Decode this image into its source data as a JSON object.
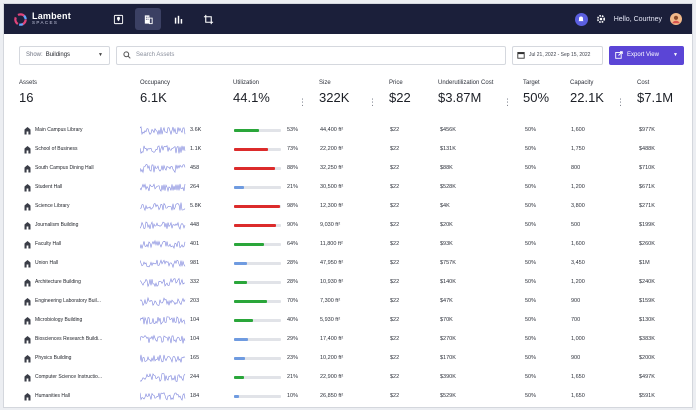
{
  "app": {
    "logo_name": "Lambent",
    "logo_sub": "SPACES",
    "greeting": "Hello, Courtney"
  },
  "nav": [
    "map-pin-icon",
    "building-icon",
    "bar-chart-icon",
    "crop-icon"
  ],
  "filters": {
    "show_label": "Show:",
    "show_value": "Buildings",
    "search_placeholder": "Search Assets",
    "date_range": "Jul 21, 2022 - Sep 15, 2022",
    "export_label": "Export View"
  },
  "summary": [
    {
      "label": "Assets",
      "value": "16"
    },
    {
      "label": "Occupancy",
      "value": "6.1K"
    },
    {
      "label": "Utilization",
      "value": "44.1%"
    },
    {
      "label": "Size",
      "value": "322K"
    },
    {
      "label": "Price",
      "value": "$22"
    },
    {
      "label": "Underutilization Cost",
      "value": "$3.87M"
    },
    {
      "label": "Target",
      "value": "50%"
    },
    {
      "label": "Capacity",
      "value": "22.1K"
    },
    {
      "label": "Cost",
      "value": "$7.1M"
    }
  ],
  "colors": {
    "good": "#2aa63a",
    "bad": "#dc2b2b",
    "low": "#6f9be0",
    "spark": "#7d85dc",
    "accent": "#5b45d6",
    "header": "#1b1f3a"
  },
  "rows": [
    {
      "name": "Main Campus Library",
      "occ": "3.6K",
      "util": "53%",
      "util_pct": 53,
      "status": "good",
      "size": "44,400 ft²",
      "price": "$22",
      "uc": "$456K",
      "target": "50%",
      "cap": "1,600",
      "cost": "$977K"
    },
    {
      "name": "School of Business",
      "occ": "1.1K",
      "util": "73%",
      "util_pct": 73,
      "status": "bad",
      "size": "22,200 ft²",
      "price": "$22",
      "uc": "$131K",
      "target": "50%",
      "cap": "1,750",
      "cost": "$488K"
    },
    {
      "name": "South Campus Dining Hall",
      "occ": "458",
      "util": "88%",
      "util_pct": 88,
      "status": "bad",
      "size": "32,250 ft²",
      "price": "$22",
      "uc": "$88K",
      "target": "50%",
      "cap": "800",
      "cost": "$710K"
    },
    {
      "name": "Student Hall",
      "occ": "264",
      "util": "21%",
      "util_pct": 21,
      "status": "low",
      "size": "30,500 ft²",
      "price": "$22",
      "uc": "$528K",
      "target": "50%",
      "cap": "1,200",
      "cost": "$671K"
    },
    {
      "name": "Science Library",
      "occ": "5.8K",
      "util": "98%",
      "util_pct": 98,
      "status": "bad",
      "size": "12,300 ft²",
      "price": "$22",
      "uc": "$4K",
      "target": "50%",
      "cap": "3,800",
      "cost": "$271K"
    },
    {
      "name": "Journalism Building",
      "occ": "448",
      "util": "90%",
      "util_pct": 90,
      "status": "bad",
      "size": "9,030 ft²",
      "price": "$22",
      "uc": "$20K",
      "target": "50%",
      "cap": "500",
      "cost": "$199K"
    },
    {
      "name": "Faculty Hall",
      "occ": "401",
      "util": "64%",
      "util_pct": 64,
      "status": "good",
      "size": "11,800 ft²",
      "price": "$22",
      "uc": "$93K",
      "target": "50%",
      "cap": "1,600",
      "cost": "$260K"
    },
    {
      "name": "Union Hall",
      "occ": "981",
      "util": "28%",
      "util_pct": 28,
      "status": "low",
      "size": "47,950 ft²",
      "price": "$22",
      "uc": "$757K",
      "target": "50%",
      "cap": "3,450",
      "cost": "$1M"
    },
    {
      "name": "Architecture Building",
      "occ": "332",
      "util": "28%",
      "util_pct": 28,
      "status": "good",
      "size": "10,930 ft²",
      "price": "$22",
      "uc": "$140K",
      "target": "50%",
      "cap": "1,200",
      "cost": "$240K"
    },
    {
      "name": "Engineering Laboratory Buil...",
      "occ": "203",
      "util": "70%",
      "util_pct": 70,
      "status": "good",
      "size": "7,300 ft²",
      "price": "$22",
      "uc": "$47K",
      "target": "50%",
      "cap": "900",
      "cost": "$159K"
    },
    {
      "name": "Microbiology Building",
      "occ": "104",
      "util": "40%",
      "util_pct": 40,
      "status": "good",
      "size": "5,930 ft²",
      "price": "$22",
      "uc": "$70K",
      "target": "50%",
      "cap": "700",
      "cost": "$130K"
    },
    {
      "name": "Biosciences Research Buildi...",
      "occ": "104",
      "util": "29%",
      "util_pct": 29,
      "status": "low",
      "size": "17,400 ft²",
      "price": "$22",
      "uc": "$270K",
      "target": "50%",
      "cap": "1,000",
      "cost": "$383K"
    },
    {
      "name": "Physics Building",
      "occ": "165",
      "util": "23%",
      "util_pct": 23,
      "status": "low",
      "size": "10,200 ft²",
      "price": "$22",
      "uc": "$170K",
      "target": "50%",
      "cap": "900",
      "cost": "$200K"
    },
    {
      "name": "Computer Science Instructio...",
      "occ": "244",
      "util": "21%",
      "util_pct": 21,
      "status": "good",
      "size": "22,900 ft²",
      "price": "$22",
      "uc": "$390K",
      "target": "50%",
      "cap": "1,650",
      "cost": "$497K"
    },
    {
      "name": "Humanities Hall",
      "occ": "184",
      "util": "10%",
      "util_pct": 10,
      "status": "low",
      "size": "26,850 ft²",
      "price": "$22",
      "uc": "$529K",
      "target": "50%",
      "cap": "1,650",
      "cost": "$591K"
    }
  ]
}
